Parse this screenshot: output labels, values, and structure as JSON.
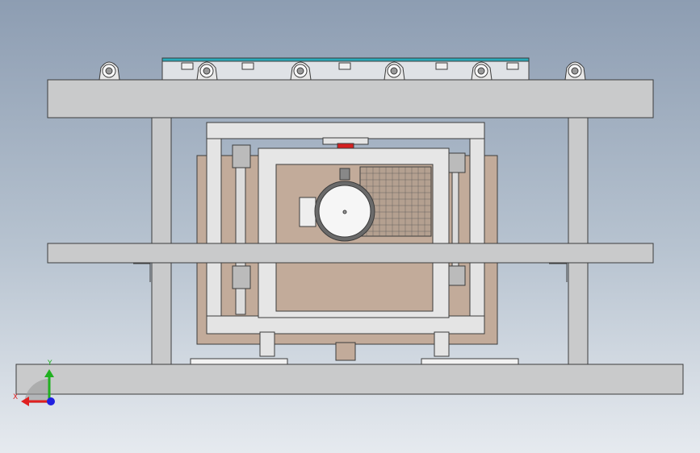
{
  "viewport": {
    "background_top": "#8d9db2",
    "background_bottom": "#e6eaef",
    "model_description_icon": "machine-frame-front-view"
  },
  "triad": {
    "x_label": "X",
    "y_label": "Y",
    "x_color": "#e02020",
    "y_color": "#20b020",
    "z_color": "#2020e0"
  },
  "colors": {
    "frame": "#c9cacb",
    "frame_edge": "#3c3c3c",
    "panel_brown": "#c2ab9a",
    "red_block": "#d42020",
    "teal_rail": "#2aa9b8"
  }
}
